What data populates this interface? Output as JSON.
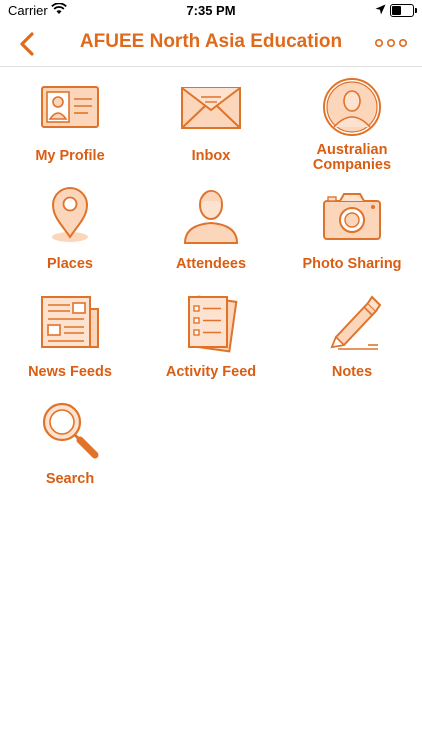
{
  "status_bar": {
    "carrier": "Carrier",
    "time": "7:35 PM"
  },
  "nav": {
    "title": "AFUEE North Asia Education"
  },
  "menu": [
    {
      "label": "My Profile",
      "icon": "profile-card-icon"
    },
    {
      "label": "Inbox",
      "icon": "envelope-icon"
    },
    {
      "label": "Australian Companies",
      "icon": "person-circle-icon"
    },
    {
      "label": "Places",
      "icon": "map-pin-icon"
    },
    {
      "label": "Attendees",
      "icon": "person-icon"
    },
    {
      "label": "Photo Sharing",
      "icon": "camera-icon"
    },
    {
      "label": "News Feeds",
      "icon": "newspaper-icon"
    },
    {
      "label": "Activity Feed",
      "icon": "checklist-icon"
    },
    {
      "label": "Notes",
      "icon": "pen-icon"
    },
    {
      "label": "Search",
      "icon": "magnifier-icon"
    }
  ],
  "colors": {
    "accent": "#e06a1b",
    "icon_stroke": "#e0732a",
    "icon_fill": "#fbd6bb"
  }
}
